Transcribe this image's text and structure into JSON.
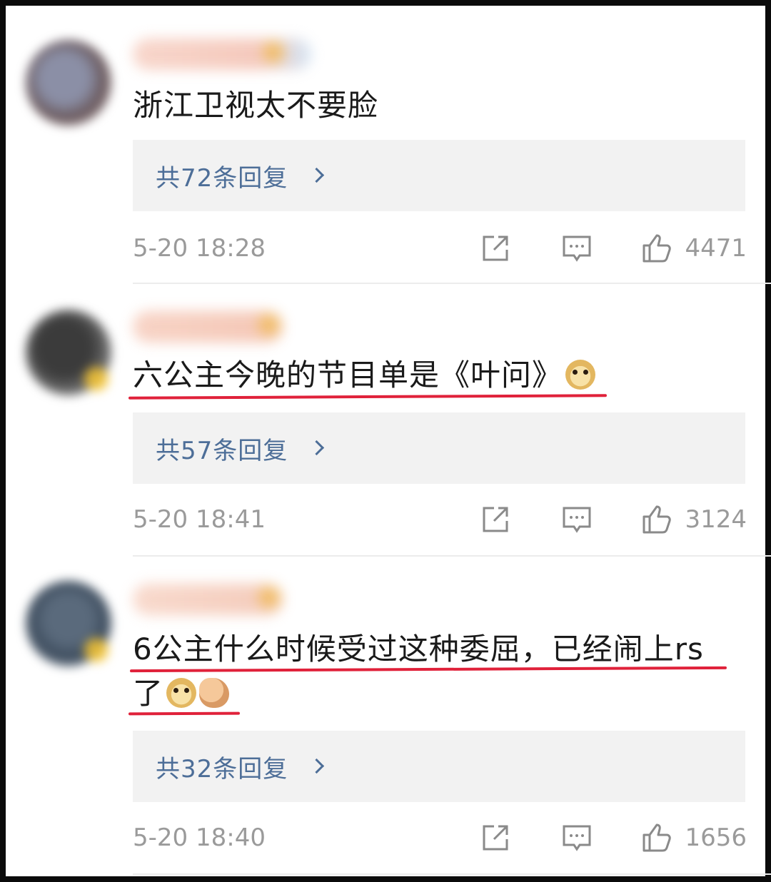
{
  "comments": [
    {
      "text": "浙江卫视太不要脸",
      "emojis": [],
      "replies_label": "共72条回复",
      "timestamp": "5-20 18:28",
      "likes": "4471",
      "underlined": false
    },
    {
      "text": "六公主今晚的节目单是《叶问》",
      "emojis": [
        "doge"
      ],
      "replies_label": "共57条回复",
      "timestamp": "5-20 18:41",
      "likes": "3124",
      "underlined": true
    },
    {
      "text": "6公主什么时候受过这种委屈，已经闹上rs",
      "text_line2": "了",
      "emojis": [
        "doge",
        "flexed-biceps"
      ],
      "replies_label": "共32条回复",
      "timestamp": "5-20 18:40",
      "likes": "1656",
      "underlined": true
    }
  ],
  "icons": {
    "share": "share-icon",
    "comment": "comment-icon",
    "like": "thumbs-up-icon"
  },
  "colors": {
    "reply_link": "#4d6e98",
    "meta_text": "#9a9a9a",
    "underline": "#e0213a",
    "reply_box": "#f2f2f2"
  }
}
